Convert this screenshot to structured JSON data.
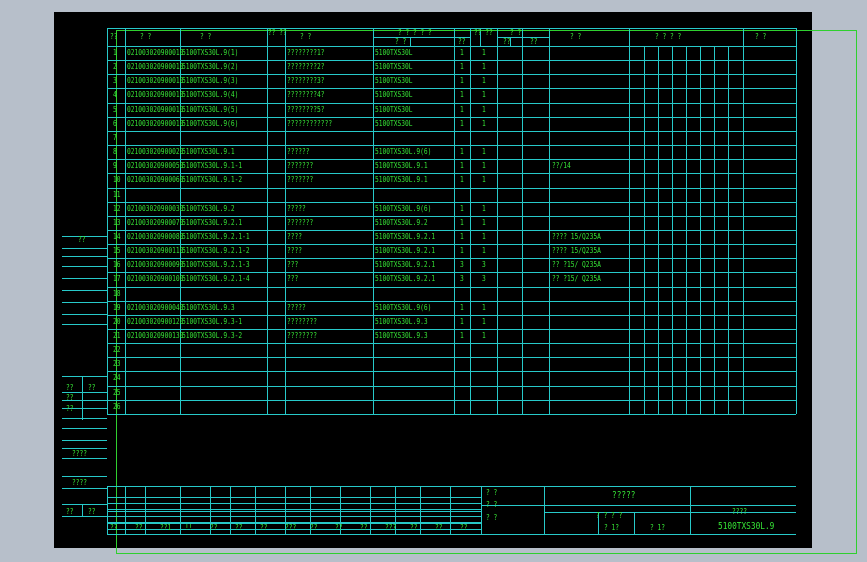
{
  "header": {
    "c1": "??",
    "c2": "?  ?",
    "c3": "?        ?",
    "c4": "?? ??",
    "c5": "?        ?",
    "c6a": "? ? ? ? ?",
    "c6b": "?        ?",
    "c7": "?? ??",
    "c7b": "??",
    "c8a": "?      ?",
    "c8b": "??",
    "c8c": "??",
    "c9": "?    ?",
    "c10": "?  ?  ?  ?",
    "c11": "?  ?"
  },
  "rows": [
    {
      "n": "1",
      "code": "021003020900010",
      "drawing": "5100TXS30L.9(1)",
      "name": "????????1?",
      "mat": "5100TXS30L",
      "q1": "1",
      "q2": "1",
      "note": ""
    },
    {
      "n": "2",
      "code": "021003020900010",
      "drawing": "5100TXS30L.9(2)",
      "name": "????????2?",
      "mat": "5100TXS30L",
      "q1": "1",
      "q2": "1",
      "note": ""
    },
    {
      "n": "3",
      "code": "021003020900010",
      "drawing": "5100TXS30L.9(3)",
      "name": "????????3?",
      "mat": "5100TXS30L",
      "q1": "1",
      "q2": "1",
      "note": ""
    },
    {
      "n": "4",
      "code": "021003020900010",
      "drawing": "5100TXS30L.9(4)",
      "name": "????????4?",
      "mat": "5100TXS30L",
      "q1": "1",
      "q2": "1",
      "note": ""
    },
    {
      "n": "5",
      "code": "021003020900010",
      "drawing": "5100TXS30L.9(5)",
      "name": "????????5?",
      "mat": "5100TXS30L",
      "q1": "1",
      "q2": "1",
      "note": ""
    },
    {
      "n": "6",
      "code": "021003020900010",
      "drawing": "5100TXS30L.9(6)",
      "name": "????????????",
      "mat": "5100TXS30L",
      "q1": "1",
      "q2": "1",
      "note": ""
    },
    {
      "n": "7",
      "code": "",
      "drawing": "",
      "name": "",
      "mat": "",
      "q1": "",
      "q2": "",
      "note": ""
    },
    {
      "n": "8",
      "code": "021003020900020",
      "drawing": "5100TXS30L.9.1",
      "name": "??????",
      "mat": "5100TXS30L.9(6)",
      "q1": "1",
      "q2": "1",
      "note": ""
    },
    {
      "n": "9",
      "code": "021003020900050",
      "drawing": "5100TXS30L.9.1-1",
      "name": "???????",
      "mat": "5100TXS30L.9.1",
      "q1": "1",
      "q2": "1",
      "note": "??/14"
    },
    {
      "n": "10",
      "code": "021003020900060",
      "drawing": "5100TXS30L.9.1-2",
      "name": "???????",
      "mat": "5100TXS30L.9.1",
      "q1": "1",
      "q2": "1",
      "note": ""
    },
    {
      "n": "11",
      "code": "",
      "drawing": "",
      "name": "",
      "mat": "",
      "q1": "",
      "q2": "",
      "note": ""
    },
    {
      "n": "12",
      "code": "021003020900030",
      "drawing": "5100TXS30L.9.2",
      "name": "?????",
      "mat": "5100TXS30L.9(6)",
      "q1": "1",
      "q2": "1",
      "note": ""
    },
    {
      "n": "13",
      "code": "021003020900070",
      "drawing": "5100TXS30L.9.2.1",
      "name": "???????",
      "mat": "5100TXS30L.9.2",
      "q1": "1",
      "q2": "1",
      "note": ""
    },
    {
      "n": "14",
      "code": "021003020900080",
      "drawing": "5100TXS30L.9.2.1-1",
      "name": "????",
      "mat": "5100TXS30L.9.2.1",
      "q1": "1",
      "q2": "1",
      "note": "???? 15/Q235A"
    },
    {
      "n": "15",
      "code": "021003020900110",
      "drawing": "5100TXS30L.9.2.1-2",
      "name": "????",
      "mat": "5100TXS30L.9.2.1",
      "q1": "1",
      "q2": "1",
      "note": "???? 15/Q235A"
    },
    {
      "n": "16",
      "code": "021003020900090",
      "drawing": "5100TXS30L.9.2.1-3",
      "name": "???",
      "mat": "5100TXS30L.9.2.1",
      "q1": "3",
      "q2": "3",
      "note": "?? ?15/ Q235A"
    },
    {
      "n": "17",
      "code": "021003020900100",
      "drawing": "5100TXS30L.9.2.1-4",
      "name": "???",
      "mat": "5100TXS30L.9.2.1",
      "q1": "3",
      "q2": "3",
      "note": "?? ?15/ Q235A"
    },
    {
      "n": "18",
      "code": "",
      "drawing": "",
      "name": "",
      "mat": "",
      "q1": "",
      "q2": "",
      "note": ""
    },
    {
      "n": "19",
      "code": "021003020900040",
      "drawing": "5100TXS30L.9.3",
      "name": "?????",
      "mat": "5100TXS30L.9(6)",
      "q1": "1",
      "q2": "1",
      "note": ""
    },
    {
      "n": "20",
      "code": "021003020900120",
      "drawing": "5100TXS30L.9.3-1",
      "name": "????????",
      "mat": "5100TXS30L.9.3",
      "q1": "1",
      "q2": "1",
      "note": ""
    },
    {
      "n": "21",
      "code": "021003020900130",
      "drawing": "5100TXS30L.9.3-2",
      "name": "????????",
      "mat": "5100TXS30L.9.3",
      "q1": "1",
      "q2": "1",
      "note": ""
    },
    {
      "n": "22",
      "code": "",
      "drawing": "",
      "name": "",
      "mat": "",
      "q1": "",
      "q2": "",
      "note": ""
    },
    {
      "n": "23",
      "code": "",
      "drawing": "",
      "name": "",
      "mat": "",
      "q1": "",
      "q2": "",
      "note": ""
    },
    {
      "n": "24",
      "code": "",
      "drawing": "",
      "name": "",
      "mat": "",
      "q1": "",
      "q2": "",
      "note": ""
    },
    {
      "n": "25",
      "code": "",
      "drawing": "",
      "name": "",
      "mat": "",
      "q1": "",
      "q2": "",
      "note": ""
    },
    {
      "n": "26",
      "code": "",
      "drawing": "",
      "name": "",
      "mat": "",
      "q1": "",
      "q2": "",
      "note": ""
    }
  ],
  "side": {
    "top": "??",
    "a": "??",
    "b": "??",
    "c": "??",
    "d": "??",
    "e": "????",
    "f": "????",
    "g": "??",
    "h": "??"
  },
  "title": {
    "r1a": "? ?",
    "r2a": "? ?",
    "r3a": "? ?",
    "main": "?????",
    "sub": "????",
    "r2b": "? ? ? ?",
    "r3b": "? 1?",
    "r3c": "? 1?",
    "drawing_no": "5100TXS30L.9",
    "bottom": [
      "??",
      "??",
      "??1",
      "!!",
      "??",
      "??",
      "??",
      "???",
      "??",
      "??",
      "??",
      "???",
      "??",
      "??",
      "??"
    ]
  }
}
